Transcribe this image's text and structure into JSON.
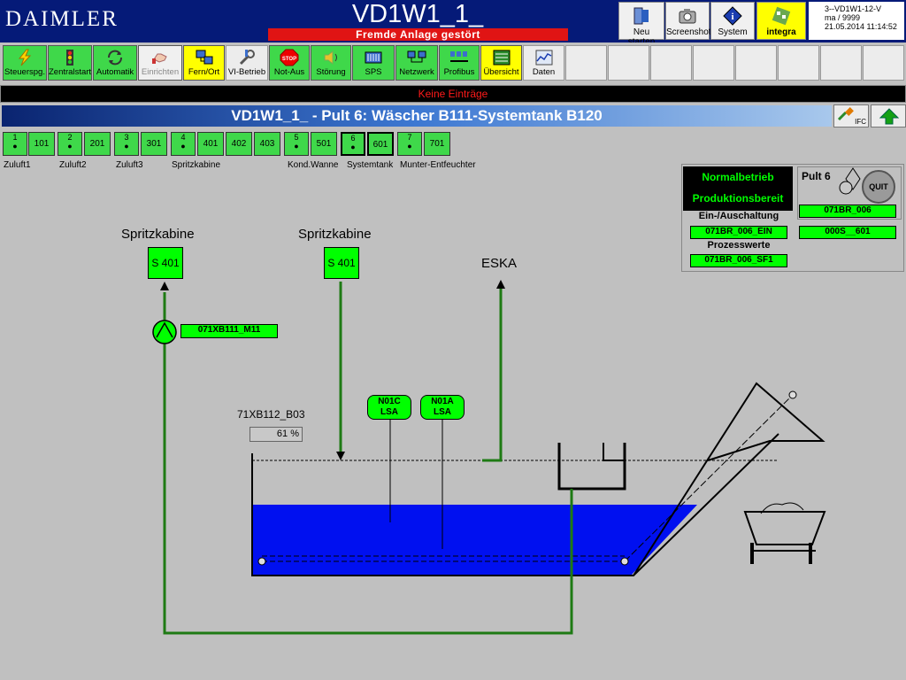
{
  "header": {
    "logo": "DAIMLER",
    "title": "VD1W1_1_",
    "alarm": "Fremde Anlage gestört"
  },
  "system_buttons": [
    {
      "label": "Neu starten",
      "icon": "restart-icon"
    },
    {
      "label": "Screenshot",
      "icon": "camera-icon"
    },
    {
      "label": "System",
      "icon": "system-info-icon"
    },
    {
      "label": "integra",
      "icon": "integra-logo-icon"
    }
  ],
  "info": {
    "line1": "3--VD1W1-12-V",
    "line2": "ma / 9999",
    "line3": "21.05.2014 11:14:52"
  },
  "toolbar": [
    {
      "label": "Steuerspg.",
      "icon": "lightning-icon",
      "state": "green"
    },
    {
      "label": "Zentralstart",
      "icon": "traffic-light-icon",
      "state": "green"
    },
    {
      "label": "Automatik",
      "icon": "automatic-cycle-icon",
      "state": "green"
    },
    {
      "label": "Einrichten",
      "icon": "hand-icon",
      "state": "grey"
    },
    {
      "label": "Fern/Ort",
      "icon": "remote-local-icon",
      "state": "yellow"
    },
    {
      "label": "VI-Betrieb",
      "icon": "wrench-icon",
      "state": "grey-text"
    },
    {
      "label": "Not-Aus",
      "icon": "stop-icon",
      "state": "green"
    },
    {
      "label": "Störung",
      "icon": "speaker-icon",
      "state": "green"
    },
    {
      "label": "SPS",
      "icon": "plc-icon",
      "state": "green"
    },
    {
      "label": "Netzwerk",
      "icon": "network-icon",
      "state": "green"
    },
    {
      "label": "Profibus",
      "icon": "profibus-icon",
      "state": "green"
    },
    {
      "label": "Übersicht",
      "icon": "overview-icon",
      "state": "yellow"
    },
    {
      "label": "Daten",
      "icon": "data-chart-icon",
      "state": "grey-text"
    }
  ],
  "message_bar": "Keine Einträge",
  "page_title": "VD1W1_1_ - Pult 6: Wäscher B111-Systemtank B120",
  "header_buttons": {
    "ifc": "IFC"
  },
  "units": [
    {
      "num": "1",
      "code": "101"
    },
    {
      "num": "2",
      "code": "201"
    },
    {
      "num": "3",
      "code": "301"
    },
    {
      "num": "4",
      "code": "401"
    },
    {
      "num": "",
      "code": "402"
    },
    {
      "num": "",
      "code": "403"
    },
    {
      "num": "5",
      "code": "501"
    },
    {
      "num": "6",
      "code": "601"
    },
    {
      "num": "7",
      "code": "701"
    }
  ],
  "unit_labels": [
    "Zuluft1",
    "Zuluft2",
    "Zuluft3",
    "Spritzkabine",
    "Kond.Wanne",
    "Systemtank",
    "Munter-Entfeuchter"
  ],
  "status_panel": {
    "normal": "Normalbetrieb",
    "ready": "Produktionsbereit",
    "switch_title": "Ein-/Auschaltung",
    "switch_tag": "071BR_006_EIN",
    "process_title": "Prozesswerte",
    "process_tag": "071BR_006_SF1",
    "pult": "Pult 6",
    "quit": "QUIT",
    "tag1": "071BR_006",
    "tag2": "000S__601"
  },
  "process": {
    "spritz1_title": "Spritzkabine",
    "spritz1_box": "S 401",
    "spritz2_title": "Spritzkabine",
    "spritz2_box": "S 401",
    "eska": "ESKA",
    "pump_tag": "071XB111_M11",
    "level_tag": "71XB112_B03",
    "level_value": "61 %",
    "level_percent": 61,
    "sensor1_top": "N01C",
    "sensor1_bot": "LSA",
    "sensor2_top": "N01A",
    "sensor2_bot": "LSA"
  },
  "colors": {
    "title_bar": "#051a78",
    "alarm": "#e01414",
    "ok_green": "#3fd84a",
    "tag_green": "#00ff00",
    "pipe": "#1e7a14",
    "water": "#0010f0"
  }
}
